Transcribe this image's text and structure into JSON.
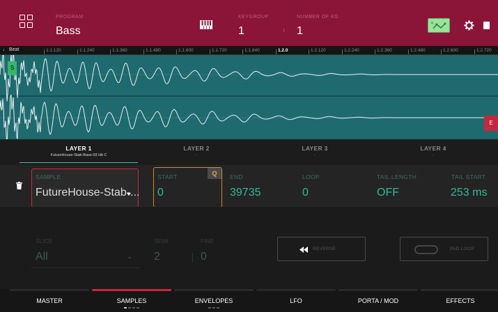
{
  "header": {
    "program_label": "PROGRAM",
    "program_value": "Bass",
    "keygroup_label": "KEYGROUP",
    "keygroup_value": "1",
    "number_label": "NUMBER OF KG",
    "number_value": "1",
    "icons": [
      "grid-icon",
      "piano-keys-icon",
      "mode-icon",
      "gear-icon",
      "chip-icon"
    ]
  },
  "ruler": {
    "beat_label": "♩ Beat",
    "ticks": [
      "1.1.120",
      "1.1.240",
      "1.1.360",
      "1.1.480",
      "1.1.600",
      "1.1.720",
      "1.1.840",
      "1.2.0",
      "1.2.120",
      "1.2.240",
      "1.2.360",
      "1.2.480",
      "1.2.600",
      "1.2.720"
    ]
  },
  "waveform": {
    "start_marker": "S",
    "end_marker": "E"
  },
  "layers": [
    {
      "name": "LAYER 1",
      "sample": "FutureHouse-Stab-Bass-03 Hit C"
    },
    {
      "name": "LAYER 2",
      "sample": "-"
    },
    {
      "name": "LAYER 3",
      "sample": "-"
    },
    {
      "name": "LAYER 4",
      "sample": "-"
    }
  ],
  "params": {
    "sample_label": "SAMPLE",
    "sample_value": "FutureHouse-Stab-...",
    "start_label": "START",
    "start_value": "0",
    "q_badge": "Q",
    "end_label": "END",
    "end_value": "39735",
    "loop_label": "LOOP",
    "loop_value": "0",
    "tail_length_label": "TAIL LENGTH",
    "tail_length_value": "OFF",
    "tail_start_label": "TAIL START",
    "tail_start_value": "253 ms"
  },
  "lower": {
    "slice_label": "SLICE",
    "slice_value": "All",
    "semi_label": "SEMI",
    "semi_value": "2",
    "fine_label": "FINE",
    "fine_value": "0",
    "reverse_label": "REVERSE",
    "padloop_label": "PAD LOOP"
  },
  "tabs": [
    {
      "label": "MASTER"
    },
    {
      "label": "SAMPLES"
    },
    {
      "label": "ENVELOPES"
    },
    {
      "label": "LFO"
    },
    {
      "label": "PORTA / MOD"
    },
    {
      "label": "EFFECTS"
    }
  ],
  "colors": {
    "header_bg": "#8a1538",
    "accent_red": "#c8283f",
    "teal_value": "#35b89a",
    "start_outline": "#d08a2e",
    "wave_bg": "#1f6a6e"
  }
}
